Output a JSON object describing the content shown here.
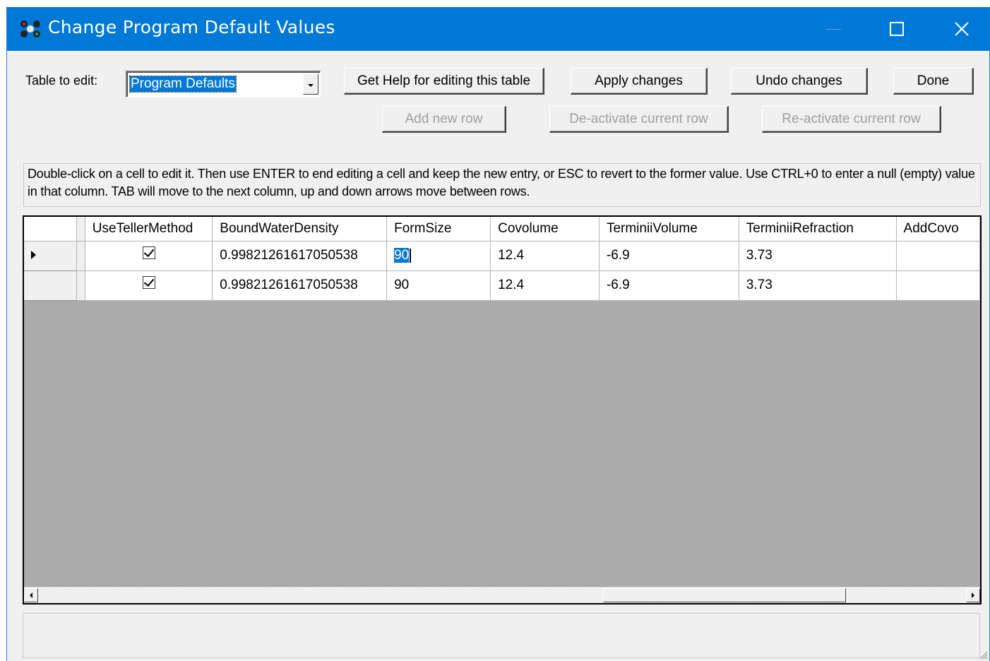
{
  "window": {
    "title": "Change Program Default Values",
    "accent_color": "#0078d7",
    "icon": "app-logo-icon"
  },
  "toolbar": {
    "table_label": "Table to edit:",
    "table_selected": "Program Defaults",
    "help_label": "Get Help for editing this table",
    "apply_label": "Apply changes",
    "undo_label": "Undo changes",
    "done_label": "Done",
    "add_row_label": "Add new row",
    "deactivate_label": "De-activate current row",
    "reactivate_label": "Re-activate current row"
  },
  "instructions": {
    "text": "Double-click on a cell to edit it. Then use ENTER to end editing a cell and keep the new entry, or ESC to revert to the former value. Use CTRL+0 to enter a null (empty) value in that column. TAB will move to the next column, up and down arrows move between rows."
  },
  "grid": {
    "columns": [
      "UseTellerMethod",
      "BoundWaterDensity",
      "FormSize",
      "Covolume",
      "TerminiiVolume",
      "TerminiiRefraction",
      "AddCovo"
    ],
    "rows": [
      {
        "use_teller": true,
        "bound_water_density": "0.99821261617050538",
        "form_size": "90",
        "covolume": "12.4",
        "terminii_volume": "-6.9",
        "terminii_refraction": "3.73",
        "add_covolume": ""
      },
      {
        "use_teller": true,
        "bound_water_density": "0.99821261617050538",
        "form_size": "90",
        "covolume": "12.4",
        "terminii_volume": "-6.9",
        "terminii_refraction": "3.73",
        "add_covolume": ""
      }
    ]
  },
  "status": {
    "text": ""
  }
}
